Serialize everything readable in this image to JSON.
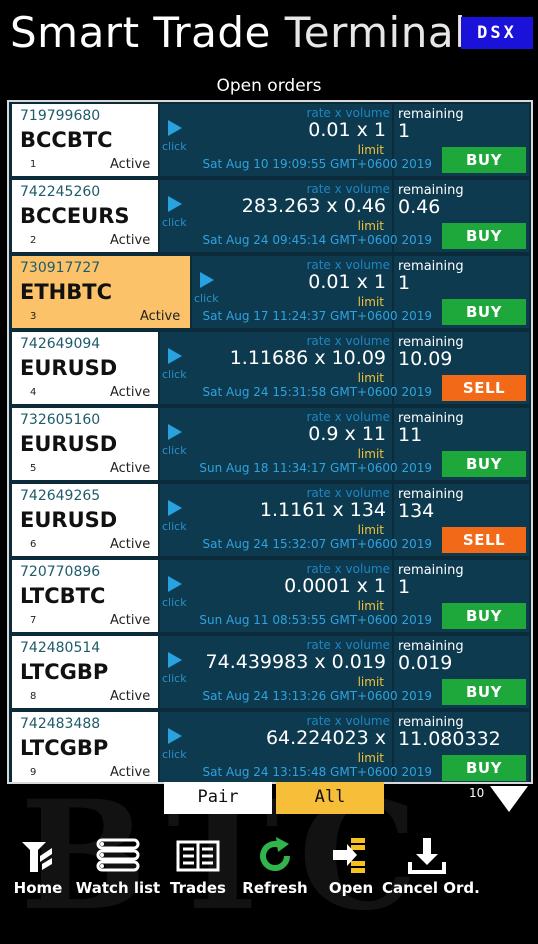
{
  "app": {
    "title_bold": "Smart Trade",
    "title_light": "Terminal",
    "badge": "DSX",
    "section_title": "Open orders"
  },
  "labels": {
    "rate_volume": "rate x volume",
    "remaining": "remaining",
    "click": "click",
    "limit": "limit"
  },
  "orders": [
    {
      "id": "719799680",
      "pair": "BCCBTC",
      "index": "1",
      "status": "Active",
      "rate_volume": "0.01 x 1",
      "remaining": "1",
      "date": "Sat Aug 10 19:09:55 GMT+0600 2019",
      "side": "BUY"
    },
    {
      "id": "742245260",
      "pair": "BCCEURS",
      "index": "2",
      "status": "Active",
      "rate_volume": "283.263 x 0.46",
      "remaining": "0.46",
      "date": "Sat Aug 24 09:45:14 GMT+0600 2019",
      "side": "BUY"
    },
    {
      "id": "730917727",
      "pair": "ETHBTC",
      "index": "3",
      "status": "Active",
      "rate_volume": "0.01 x 1",
      "remaining": "1",
      "date": "Sat Aug 17 11:24:37 GMT+0600 2019",
      "side": "BUY"
    },
    {
      "id": "742649094",
      "pair": "EURUSD",
      "index": "4",
      "status": "Active",
      "rate_volume": "1.11686 x 10.09",
      "remaining": "10.09",
      "date": "Sat Aug 24 15:31:58 GMT+0600 2019",
      "side": "SELL"
    },
    {
      "id": "732605160",
      "pair": "EURUSD",
      "index": "5",
      "status": "Active",
      "rate_volume": "0.9 x 11",
      "remaining": "11",
      "date": "Sun Aug 18 11:34:17 GMT+0600 2019",
      "side": "BUY"
    },
    {
      "id": "742649265",
      "pair": "EURUSD",
      "index": "6",
      "status": "Active",
      "rate_volume": "1.1161 x 134",
      "remaining": "134",
      "date": "Sat Aug 24 15:32:07 GMT+0600 2019",
      "side": "SELL"
    },
    {
      "id": "720770896",
      "pair": "LTCBTC",
      "index": "7",
      "status": "Active",
      "rate_volume": "0.0001 x 1",
      "remaining": "1",
      "date": "Sun Aug 11 08:53:55 GMT+0600 2019",
      "side": "BUY"
    },
    {
      "id": "742480514",
      "pair": "LTCGBP",
      "index": "8",
      "status": "Active",
      "rate_volume": "74.439983 x 0.019",
      "remaining": "0.019",
      "date": "Sat Aug 24 13:13:26 GMT+0600 2019",
      "side": "BUY"
    },
    {
      "id": "742483488",
      "pair": "LTCGBP",
      "index": "9",
      "status": "Active",
      "rate_volume": "64.224023 x",
      "remaining": "11.080332",
      "date": "Sat Aug 24 13:15:48 GMT+0600 2019",
      "side": "BUY"
    }
  ],
  "selected_order_index": 2,
  "filters": {
    "pair": "Pair",
    "all": "All",
    "active": "All"
  },
  "page_count": "10",
  "nav": {
    "home": "Home",
    "watch_list": "Watch list",
    "trades": "Trades",
    "refresh": "Refresh",
    "open": "Open",
    "cancel": "Cancel Ord."
  },
  "colors": {
    "buy": "#1ea73a",
    "sell": "#f26a17",
    "selected": "#fbc26a",
    "badge": "#1a12d8",
    "filter_active": "#f7be3a"
  }
}
